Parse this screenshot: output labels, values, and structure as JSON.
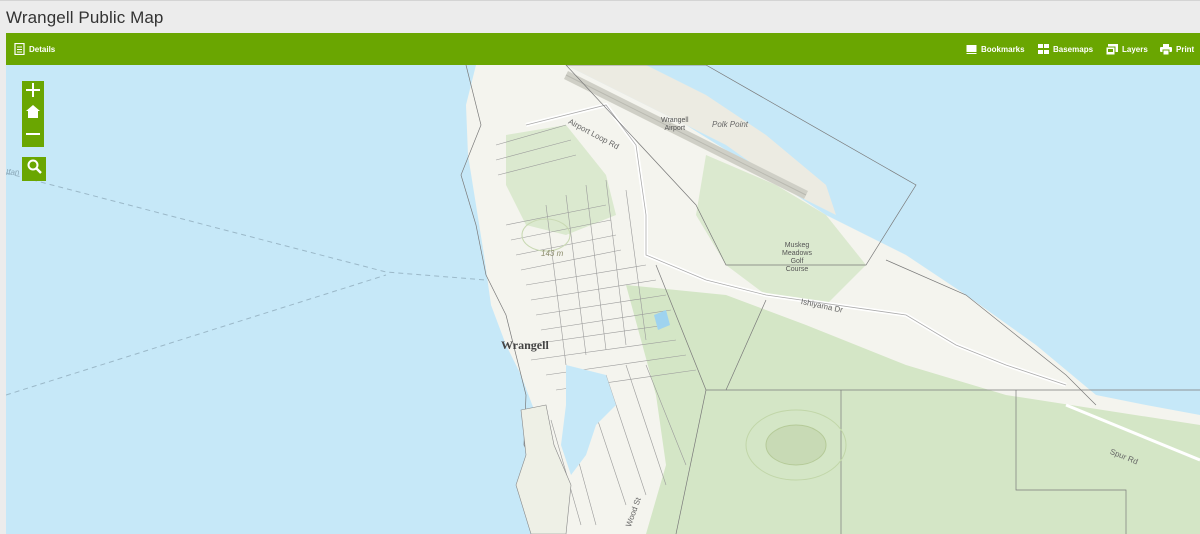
{
  "app": {
    "title": "Wrangell Public Map"
  },
  "toolbar": {
    "details_label": "Details",
    "bookmarks_label": "Bookmarks",
    "basemaps_label": "Basemaps",
    "layers_label": "Layers",
    "print_label": "Print"
  },
  "map_controls": {
    "zoom_in": "zoom-in",
    "home": "home",
    "zoom_out": "zoom-out",
    "search": "search"
  },
  "map_labels": {
    "town": "Wrangell",
    "airport": "Wrangell\nAirport",
    "airport_line1": "Wrangell",
    "airport_line2": "Airport",
    "point": "Polk Point",
    "airport_road": "Airport Loop Rd",
    "golf_line1": "Muskeg",
    "golf_line2": "Meadows",
    "golf_line3": "Golf",
    "golf_line4": "Course",
    "elevation": "143 m",
    "road_ishiyama": "Ishiyama Dr",
    "road_spur": "Spur Rd",
    "road_wood": "Wood St",
    "edge_fragment": "Ifan"
  },
  "colors": {
    "toolbar": "#6aa601",
    "water": "#c6e8f8",
    "land": "#f4f4ee",
    "forest": "#dbe9cf"
  }
}
